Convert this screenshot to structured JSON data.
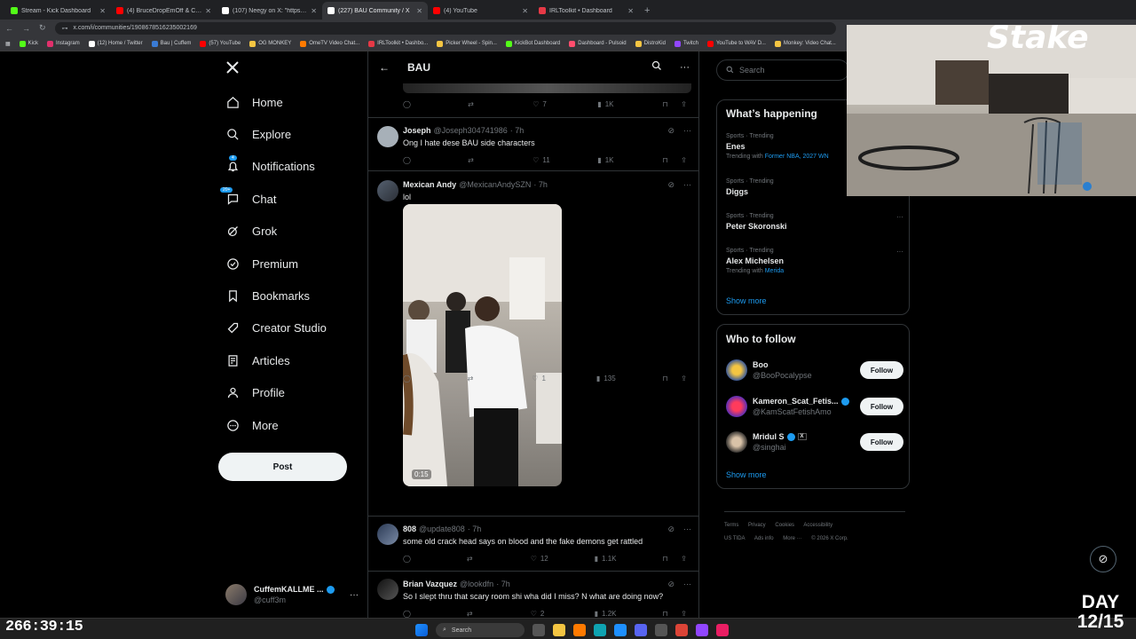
{
  "browser": {
    "tabs": [
      {
        "label": "Stream - Kick Dashboard",
        "color": "#53fc18"
      },
      {
        "label": "(4) BruceDropEmOff & Cuffem",
        "color": "#ff0000"
      },
      {
        "label": "(107) Neegy on X: \"https://t.co",
        "color": "#ffffff"
      },
      {
        "label": "(227) BAU Community / X",
        "color": "#ffffff"
      },
      {
        "label": "(4) YouTube",
        "color": "#ff0000"
      },
      {
        "label": "IRLToolkit • Dashboard",
        "color": "#e63946"
      }
    ],
    "new_tab": "+",
    "url": "x.com/i/communities/1908678516235002169",
    "bookmarks": [
      {
        "label": "Kick",
        "color": "#53fc18"
      },
      {
        "label": "Instagram",
        "color": "#e1306c"
      },
      {
        "label": "(12) Home / Twitter",
        "color": "#ffffff"
      },
      {
        "label": "Bau | Cuffem",
        "color": "#3a7bd5"
      },
      {
        "label": "(57) YouTube",
        "color": "#ff0000"
      },
      {
        "label": "OG MONKEY",
        "color": "#f4c542"
      },
      {
        "label": "OmeTV Video Chat...",
        "color": "#ff7a00"
      },
      {
        "label": "IRLToolkit • Dashbo...",
        "color": "#e63946"
      },
      {
        "label": "Picker Wheel - Spin...",
        "color": "#f4c542"
      },
      {
        "label": "KickBot Dashboard",
        "color": "#53fc18"
      },
      {
        "label": "Dashboard - Pulsoid",
        "color": "#ff4d6d"
      },
      {
        "label": "DistroKid",
        "color": "#f4c542"
      },
      {
        "label": "Twitch",
        "color": "#9146ff"
      },
      {
        "label": "YouTube to WAV D...",
        "color": "#ff0000"
      },
      {
        "label": "Monkey: Video Chat...",
        "color": "#f4c542"
      }
    ]
  },
  "nav": {
    "items": [
      {
        "label": "Home",
        "icon": "home-icon"
      },
      {
        "label": "Explore",
        "icon": "search-icon"
      },
      {
        "label": "Notifications",
        "icon": "bell-icon",
        "badge": "4"
      },
      {
        "label": "Chat",
        "icon": "chat-icon",
        "badge": "20+"
      },
      {
        "label": "Grok",
        "icon": "grok-icon"
      },
      {
        "label": "Premium",
        "icon": "premium-icon"
      },
      {
        "label": "Bookmarks",
        "icon": "bookmark-icon"
      },
      {
        "label": "Creator Studio",
        "icon": "rocket-icon"
      },
      {
        "label": "Articles",
        "icon": "articles-icon"
      },
      {
        "label": "Profile",
        "icon": "profile-icon"
      },
      {
        "label": "More",
        "icon": "more-icon"
      }
    ],
    "post_label": "Post",
    "account": {
      "name": "CuffemKALLME ...",
      "handle": "@cuff3m"
    }
  },
  "community": {
    "title": "BAU",
    "top_stats": {
      "likes": "7",
      "views": "1K"
    },
    "tweets": [
      {
        "name": "Joseph",
        "handle": "@Joseph304741986",
        "time": "· 7h",
        "text": "Ong I hate dese BAU side characters",
        "likes": "11",
        "views": "1K"
      },
      {
        "name": "Mexican Andy",
        "handle": "@MexicanAndySZN",
        "time": "· 7h",
        "text": "lol",
        "likes": "1",
        "views": "135",
        "video_duration": "0:15"
      },
      {
        "name": "808",
        "handle": "@update808",
        "time": "· 7h",
        "text": "some old crack head says on blood and the fake demons  get rattled",
        "likes": "12",
        "views": "1.1K"
      },
      {
        "name": "Brian Vazquez",
        "handle": "@lookdfn",
        "time": "· 7h",
        "text": "So I slept thru that scary room shi wha did I miss? N what are doing now?",
        "likes": "2",
        "views": "1.2K"
      }
    ]
  },
  "sidebar": {
    "search_placeholder": "Search",
    "happening_title": "What’s happening",
    "trends": [
      {
        "category": "Sports · Trending",
        "name": "Enes",
        "with_label": "Trending with",
        "with_link": "Former NBA, 2027 WN"
      },
      {
        "category": "Sports · Trending",
        "name": "Diggs"
      },
      {
        "category": "Sports · Trending",
        "name": "Peter Skoronski"
      },
      {
        "category": "Sports · Trending",
        "name": "Alex Michelsen",
        "with_label": "Trending with",
        "with_link": "Merida"
      }
    ],
    "show_more": "Show more",
    "follow_title": "Who to follow",
    "follow": [
      {
        "name": "Boo",
        "handle": "@BooPocalypse",
        "button": "Follow"
      },
      {
        "name": "Kameron_Scat_Fetis...",
        "handle": "@KamScatFetishAmo",
        "button": "Follow"
      },
      {
        "name": "Mridul S",
        "handle": "@singhai",
        "button": "Follow"
      }
    ],
    "show_more_2": "Show more",
    "footer": [
      "Terms",
      "Privacy",
      "Cookies",
      "Accessibility",
      "US TIDA",
      "Ads info",
      "More ···",
      "© 2026 X Corp."
    ]
  },
  "overlay": {
    "webcam_brand": "Stake",
    "timer": "266:39:15",
    "day_line1": "DAY",
    "day_line2": "12/15"
  },
  "taskbar": {
    "search_placeholder": "Search"
  }
}
